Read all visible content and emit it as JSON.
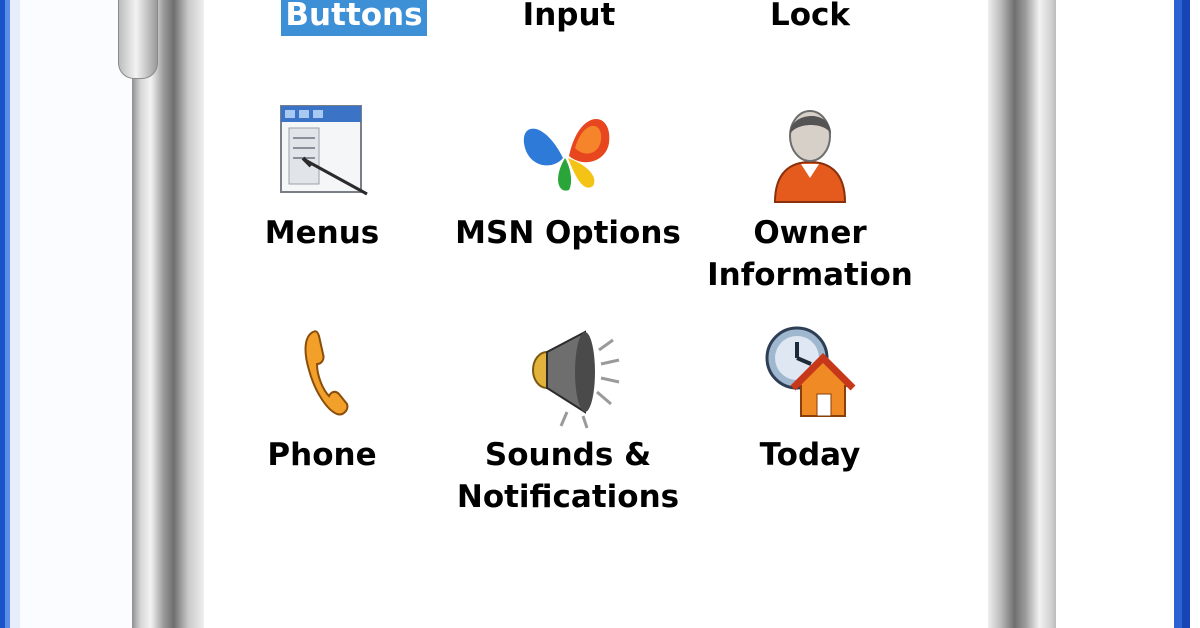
{
  "items": [
    {
      "label": "Buttons",
      "icon": "buttons-icon",
      "selected": true
    },
    {
      "label": "Input",
      "icon": "input-icon"
    },
    {
      "label": "Lock",
      "icon": "lock-icon"
    },
    {
      "label": "Menus",
      "icon": "menus-icon"
    },
    {
      "label": "MSN Options",
      "icon": "msn-butterfly-icon"
    },
    {
      "label_line1": "Owner",
      "label_line2": "Information",
      "icon": "owner-person-icon"
    },
    {
      "label": "Phone",
      "icon": "phone-handset-icon"
    },
    {
      "label_line1": "Sounds &",
      "label_line2": "Notifications",
      "icon": "speaker-icon"
    },
    {
      "label": "Today",
      "icon": "clock-house-icon"
    }
  ],
  "colors": {
    "selection": "#3d8fd6",
    "window_border": "#1a54c8"
  }
}
